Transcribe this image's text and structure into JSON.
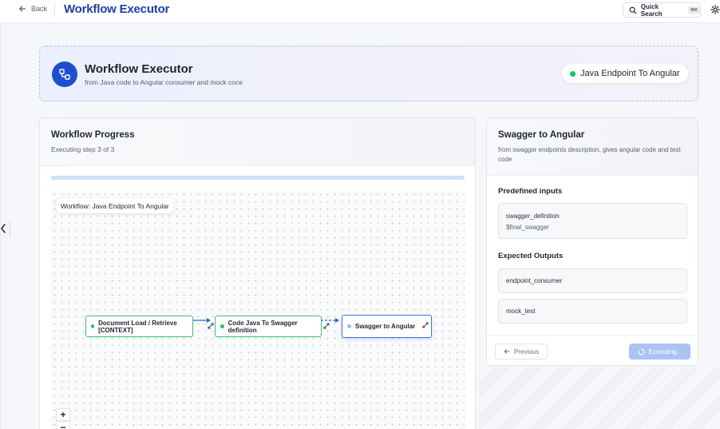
{
  "topbar": {
    "back_label": "Back",
    "title": "Workflow Executor",
    "quick_search_label": "Quick Search",
    "quick_search_shortcut": "⌘K"
  },
  "header": {
    "title": "Workflow Executor",
    "subtitle": "from Java code to Angular consumer and mock coce",
    "workflow_pill": "Java Endpoint To Angular",
    "pill_status_color": "#22c55e"
  },
  "progress": {
    "title": "Workflow Progress",
    "subtitle": "Executing step 3 of 3",
    "canvas_label": "Workflow: Java Endpoint To Angular",
    "nodes": [
      {
        "label": "Document Load / Retrieve [CONTEXT]",
        "status": "done"
      },
      {
        "label": "Code Java To Swagger definition",
        "status": "done"
      },
      {
        "label": "Swagger to Angular",
        "status": "active"
      }
    ],
    "zoom_in": "+",
    "zoom_out": "−"
  },
  "step": {
    "title": "Swagger to Angular",
    "description": "from swagger endpoints description, gives angular code and test code",
    "inputs_title": "Predefined inputs",
    "inputs": [
      {
        "name": "swagger_definition",
        "value": "$final_swagger"
      }
    ],
    "outputs_title": "Expected Outputs",
    "outputs": [
      {
        "name": "endpoint_consumer"
      },
      {
        "name": "mock_test"
      }
    ],
    "previous_label": "Previous",
    "executing_label": "Executing..."
  },
  "colors": {
    "accent": "#1e4fcf",
    "title_blue": "#1d3fa6",
    "done_green": "#3fbf6c",
    "active_blue": "#3b78d9"
  }
}
